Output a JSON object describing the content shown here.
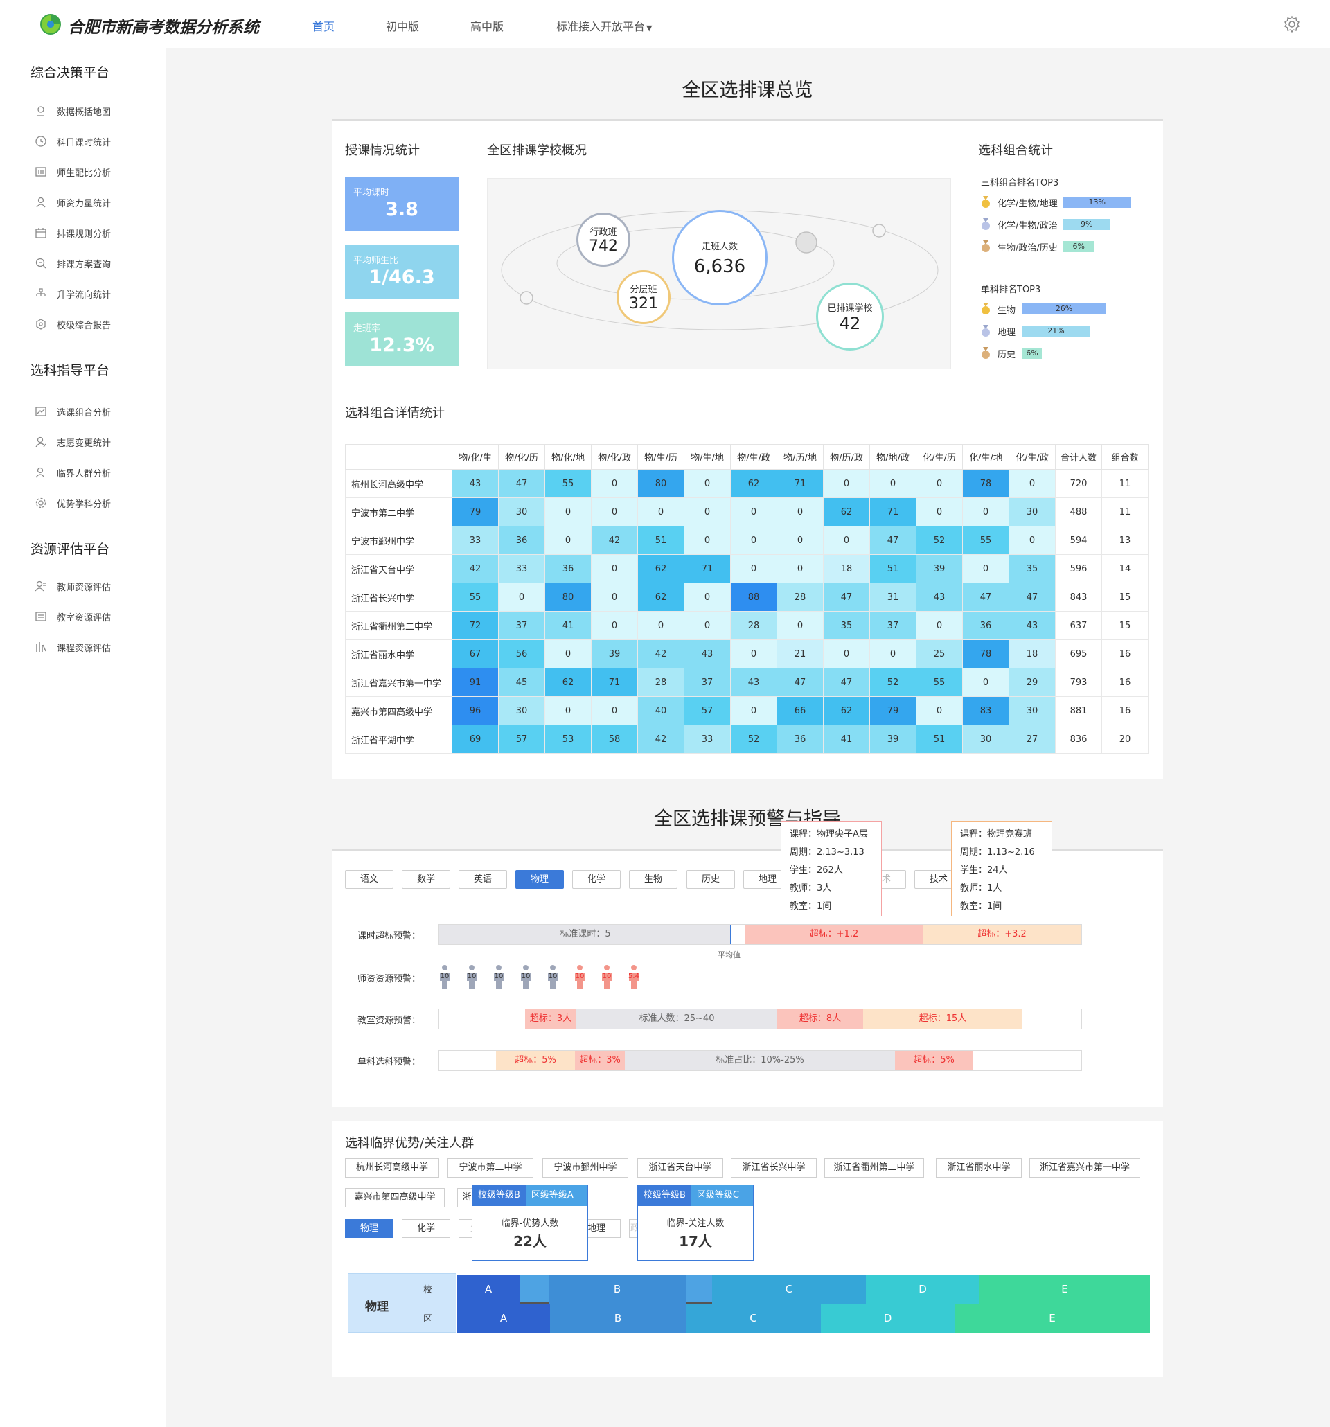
{
  "header": {
    "brand": "合肥市新高考数据分析系统",
    "nav": [
      {
        "label": "首页",
        "active": true
      },
      {
        "label": "初中版",
        "active": false
      },
      {
        "label": "高中版",
        "active": false
      },
      {
        "label": "标准接入开放平台",
        "active": false
      }
    ]
  },
  "sidebar": {
    "groups": [
      {
        "title": "综合决策平台",
        "items": [
          {
            "label": "数据概括地图",
            "icon": "map-pin-icon"
          },
          {
            "label": "科目课时统计",
            "icon": "clock-icon"
          },
          {
            "label": "师生配比分析",
            "icon": "grid-icon"
          },
          {
            "label": "师资力量统计",
            "icon": "user-icon"
          },
          {
            "label": "排课规则分析",
            "icon": "calendar-icon"
          },
          {
            "label": "排课方案查询",
            "icon": "search-doc-icon"
          },
          {
            "label": "升学流向统计",
            "icon": "hierarchy-icon"
          },
          {
            "label": "校级综合报告",
            "icon": "hexagon-icon"
          }
        ]
      },
      {
        "title": "选科指导平台",
        "items": [
          {
            "label": "选课组合分析",
            "icon": "chart-icon"
          },
          {
            "label": "志愿变更统计",
            "icon": "user-edit-icon"
          },
          {
            "label": "临界人群分析",
            "icon": "user-group-icon"
          },
          {
            "label": "优势学科分析",
            "icon": "gear-icon"
          }
        ]
      },
      {
        "title": "资源评估平台",
        "items": [
          {
            "label": "教师资源评估",
            "icon": "teacher-icon"
          },
          {
            "label": "教室资源评估",
            "icon": "classroom-icon"
          },
          {
            "label": "课程资源评估",
            "icon": "books-icon"
          }
        ]
      }
    ]
  },
  "overview": {
    "title": "全区选排课总览",
    "teaching": {
      "title": "授课情况统计",
      "stats": [
        {
          "label": "平均课时",
          "value": "3.8",
          "color": "#7fb0f5"
        },
        {
          "label": "平均师生比",
          "value": "1/46.3",
          "color": "#8fd5ee"
        },
        {
          "label": "走班率",
          "value": "12.3%",
          "color": "#9ee3d6"
        }
      ]
    },
    "schools": {
      "title": "全区排课学校概况",
      "bubbles": [
        {
          "label": "行政班",
          "value": "742"
        },
        {
          "label": "走班人数",
          "value": "6,636"
        },
        {
          "label": "分层班",
          "value": "321"
        },
        {
          "label": "已排课学校",
          "value": "42"
        }
      ]
    },
    "combos": {
      "title": "选科组合统计",
      "top3_title": "三科组合排名TOP3",
      "top3": [
        {
          "name": "化学/生物/地理",
          "pct": "13%",
          "value": 13,
          "color": "#8ab6f5"
        },
        {
          "name": "化学/生物/政治",
          "pct": "9%",
          "value": 9,
          "color": "#9ddaf0"
        },
        {
          "name": "生物/政治/历史",
          "pct": "6%",
          "value": 6,
          "color": "#a5e6d4"
        }
      ],
      "single_title": "单科排名TOP3",
      "single": [
        {
          "name": "生物",
          "pct": "26%",
          "value": 26,
          "color": "#8ab6f5"
        },
        {
          "name": "地理",
          "pct": "21%",
          "value": 21,
          "color": "#9ddaf0"
        },
        {
          "name": "历史",
          "pct": "6%",
          "value": 6,
          "color": "#a5e6d4"
        }
      ]
    },
    "detail": {
      "title": "选科组合详情统计",
      "columns": [
        "物/化/生",
        "物/化/历",
        "物/化/地",
        "物/化/政",
        "物/生/历",
        "物/生/地",
        "物/生/政",
        "物/历/地",
        "物/历/政",
        "物/地/政",
        "化/生/历",
        "化/生/地",
        "化/生/政"
      ],
      "total_header": "合计人数",
      "count_header": "组合数",
      "rows": [
        {
          "school": "杭州长河高级中学",
          "values": [
            43,
            47,
            55,
            0,
            80,
            0,
            62,
            71,
            0,
            0,
            0,
            78,
            0
          ],
          "total": "720",
          "count": "11"
        },
        {
          "school": "宁波市第二中学",
          "values": [
            79,
            30,
            0,
            0,
            0,
            0,
            0,
            0,
            62,
            71,
            0,
            0,
            30
          ],
          "total": "488",
          "count": "11"
        },
        {
          "school": "宁波市鄞州中学",
          "values": [
            33,
            36,
            0,
            42,
            51,
            0,
            0,
            0,
            0,
            47,
            52,
            55,
            0
          ],
          "total": "594",
          "count": "13"
        },
        {
          "school": "浙江省天台中学",
          "values": [
            42,
            33,
            36,
            0,
            62,
            71,
            0,
            0,
            18,
            51,
            39,
            0,
            35
          ],
          "total": "596",
          "count": "14"
        },
        {
          "school": "浙江省长兴中学",
          "values": [
            55,
            0,
            80,
            0,
            62,
            0,
            88,
            28,
            47,
            31,
            43,
            47,
            47
          ],
          "total": "843",
          "count": "15"
        },
        {
          "school": "浙江省衢州第二中学",
          "values": [
            72,
            37,
            41,
            0,
            0,
            0,
            28,
            0,
            35,
            37,
            0,
            36,
            43
          ],
          "total": "637",
          "count": "15"
        },
        {
          "school": "浙江省丽水中学",
          "values": [
            67,
            56,
            0,
            39,
            42,
            43,
            0,
            21,
            0,
            0,
            25,
            78,
            18
          ],
          "total": "695",
          "count": "16"
        },
        {
          "school": "浙江省嘉兴市第一中学",
          "values": [
            91,
            45,
            62,
            71,
            28,
            37,
            43,
            47,
            47,
            52,
            55,
            0,
            29
          ],
          "total": "793",
          "count": "16"
        },
        {
          "school": "嘉兴市第四高级中学",
          "values": [
            96,
            30,
            0,
            0,
            40,
            57,
            0,
            66,
            62,
            79,
            0,
            83,
            30
          ],
          "total": "881",
          "count": "16"
        },
        {
          "school": "浙江省平湖中学",
          "values": [
            69,
            57,
            53,
            58,
            42,
            33,
            52,
            36,
            41,
            39,
            51,
            30,
            27
          ],
          "total": "836",
          "count": "20"
        }
      ]
    }
  },
  "warning": {
    "title": "全区选排课预警与指导",
    "subjects": [
      "语文",
      "数学",
      "英语",
      "物理",
      "化学",
      "生物",
      "历史",
      "地理",
      "艺术",
      "技术"
    ],
    "active_subject": "物理",
    "hours": {
      "label": "课时超标预警：",
      "standard": "标准课时：5",
      "avg": "平均值",
      "over1": "超标：+1.2",
      "over2": "超标：+3.2",
      "tip1": [
        "课程：物理尖子A层",
        "周期：2.13~3.13",
        "学生：262人",
        "教师：3人",
        "教室：1间"
      ],
      "tip2": [
        "课程：物理竞赛班",
        "周期：1.13~2.16",
        "学生：24人",
        "教师：1人",
        "教室：1间"
      ]
    },
    "teachers": {
      "label": "师资资源预警：",
      "figures": [
        {
          "n": "10",
          "over": false
        },
        {
          "n": "10",
          "over": false
        },
        {
          "n": "10",
          "over": false
        },
        {
          "n": "10",
          "over": false
        },
        {
          "n": "10",
          "over": false
        },
        {
          "n": "10",
          "over": true
        },
        {
          "n": "10",
          "over": true
        },
        {
          "n": "5.4",
          "over": true
        }
      ]
    },
    "rooms": {
      "label": "教室资源预警：",
      "segs": [
        "超标：3人",
        "标准人数：25~40",
        "超标：8人",
        "超标：15人"
      ]
    },
    "single": {
      "label": "单科选科预警：",
      "segs": [
        "超标：5%",
        "超标：3%",
        "标准占比：10%-25%",
        "超标：5%"
      ]
    }
  },
  "critical": {
    "title": "选科临界优势/关注人群",
    "schools": [
      "杭州长河高级中学",
      "宁波市第二中学",
      "宁波市鄞州中学",
      "浙江省天台中学",
      "浙江省长兴中学",
      "浙江省衢州第二中学",
      "浙江省丽水中学",
      "浙江省嘉兴市第一中学",
      "嘉兴市第四高级中学",
      "浙"
    ],
    "subjects": [
      "物理",
      "化学",
      "生物",
      "地理",
      "政治"
    ],
    "active_subject": "物理",
    "pop1": {
      "a": "校级等级B",
      "b": "区级等级A",
      "label": "临界-优势人数",
      "value": "22人"
    },
    "pop2": {
      "a": "校级等级B",
      "b": "区级等级C",
      "label": "临界-关注人数",
      "value": "17人"
    },
    "subject_label": "物理",
    "row_school": "校",
    "row_district": "区",
    "grades": [
      "A",
      "B",
      "C",
      "D",
      "E"
    ]
  }
}
